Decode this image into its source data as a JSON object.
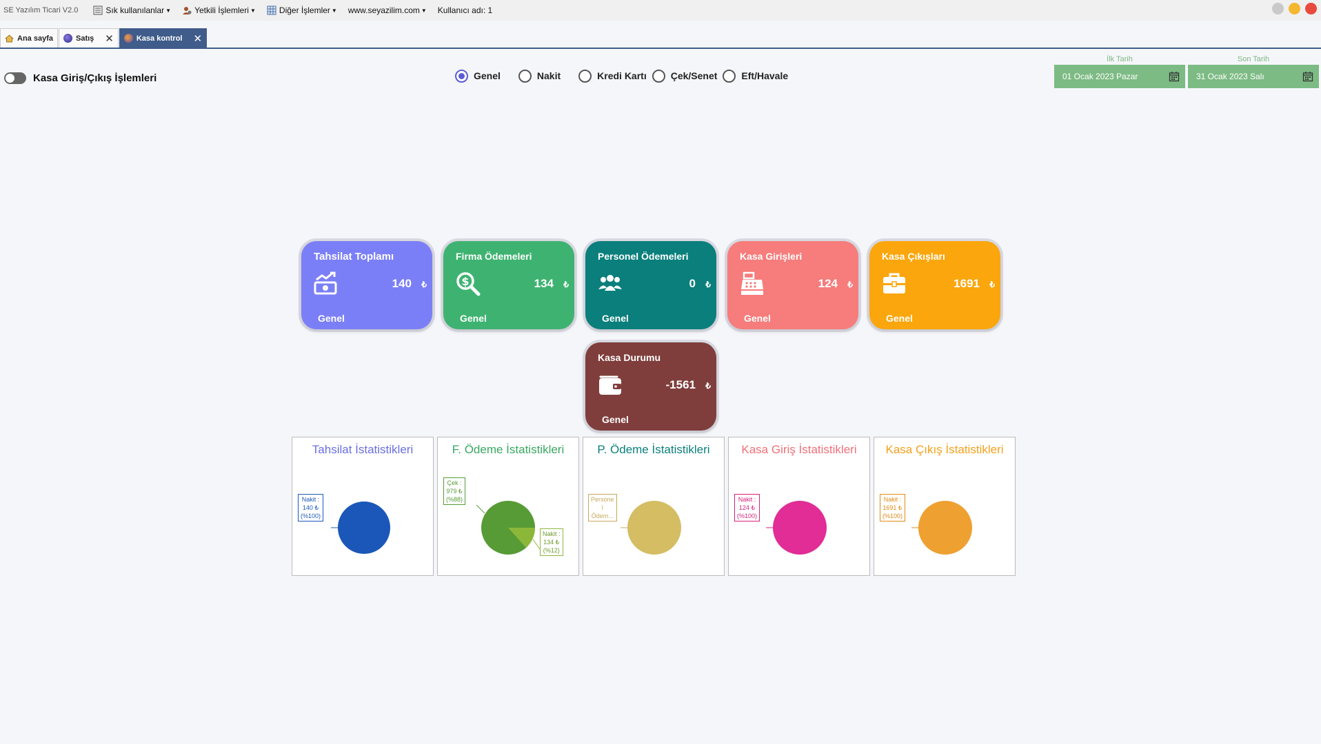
{
  "app": {
    "title": "SE Yazılım Ticari V2.0",
    "menu": [
      {
        "label": "Sık kullanılanlar",
        "icon": "menu-list-icon"
      },
      {
        "label": "Yetkili İşlemleri",
        "icon": "user-gear-icon"
      },
      {
        "label": "Diğer İşlemler",
        "icon": "grid-calc-icon"
      },
      {
        "label": "www.seyazilim.com",
        "icon": ""
      },
      {
        "label": "Kullanıcı adı: 1",
        "icon": ""
      }
    ],
    "window_buttons": [
      {
        "name": "maximize",
        "color": "#c9c9c9"
      },
      {
        "name": "minimize",
        "color": "#f5b731"
      },
      {
        "name": "close",
        "color": "#e84b3c"
      }
    ]
  },
  "tabs": [
    {
      "label": "Ana sayfa",
      "icon": "home-icon",
      "closable": false,
      "active": false
    },
    {
      "label": "Satış",
      "icon": "sales-globe-icon",
      "closable": true,
      "active": false
    },
    {
      "label": "Kasa kontrol",
      "icon": "cash-control-icon",
      "closable": true,
      "active": true
    }
  ],
  "toggle": {
    "label": "Kasa Giriş/Çıkış İşlemleri",
    "on": false
  },
  "payment_types": {
    "options": [
      "Genel",
      "Nakit",
      "Kredi Kartı",
      "Çek/Senet",
      "Eft/Havale"
    ],
    "selected": "Genel"
  },
  "dates": {
    "start": {
      "label": "İlk Tarih",
      "value": "01 Ocak 2023 Pazar"
    },
    "end": {
      "label": "Son Tarih",
      "value": "31 Ocak 2023 Salı"
    }
  },
  "cards": [
    {
      "title": "Tahsilat Toplamı",
      "value": "140",
      "currency": "₺",
      "footer": "Genel",
      "color": "#7b7ff7",
      "icon": "money-chart-icon"
    },
    {
      "title": "Firma Ödemeleri",
      "value": "134",
      "currency": "₺",
      "footer": "Genel",
      "color": "#3eb371",
      "icon": "dollar-search-icon"
    },
    {
      "title": "Personel Ödemeleri",
      "value": "0",
      "currency": "₺",
      "footer": "Genel",
      "color": "#0a7f7c",
      "icon": "people-icon"
    },
    {
      "title": "Kasa Girişleri",
      "value": "124",
      "currency": "₺",
      "footer": "Genel",
      "color": "#f77c7c",
      "icon": "cash-register-icon"
    },
    {
      "title": "Kasa Çıkışları",
      "value": "1691",
      "currency": "₺",
      "footer": "Genel",
      "color": "#fba60c",
      "icon": "briefcase-icon"
    },
    {
      "title": "Kasa Durumu",
      "value": "-1561",
      "currency": "₺",
      "footer": "Genel",
      "color": "#7f3e3c",
      "icon": "wallet-icon"
    }
  ],
  "stats": [
    {
      "title": "Tahsilat İstatistikleri",
      "color": "#6a6ee0",
      "slices": [
        {
          "value": 100,
          "color": "#1b57b8"
        }
      ],
      "labels": [
        [
          "Nakit :",
          "140 ₺",
          "(%100)"
        ]
      ],
      "label_color": "#1b57b8"
    },
    {
      "title": "F. Ödeme İstatistikleri",
      "color": "#38a862",
      "slices": [
        {
          "value": 88,
          "color": "#579b36"
        },
        {
          "value": 12,
          "color": "#8cb83a"
        }
      ],
      "labels": [
        [
          "Çek :",
          "979 ₺",
          "(%88)"
        ],
        [
          "Nakit :",
          "134 ₺",
          "(%12)"
        ]
      ],
      "label_color": "#579b36"
    },
    {
      "title": "P. Ödeme İstatistikleri",
      "color": "#0b7f7b",
      "slices": [
        {
          "value": 100,
          "color": "#d4bd62"
        }
      ],
      "labels": [
        [
          "Persone",
          "l",
          "Ödem..."
        ]
      ],
      "label_color": "#c5a85a"
    },
    {
      "title": "Kasa Giriş İstatistikleri",
      "color": "#f06f79",
      "slices": [
        {
          "value": 100,
          "color": "#e12d95"
        }
      ],
      "labels": [
        [
          "Nakit :",
          "124 ₺",
          "(%100)"
        ]
      ],
      "label_color": "#d81f78"
    },
    {
      "title": "Kasa Çıkış İstatistikleri",
      "color": "#f4a01a",
      "slices": [
        {
          "value": 100,
          "color": "#eea030"
        }
      ],
      "labels": [
        [
          "Nakit :",
          "1691 ₺",
          "(%100)"
        ]
      ],
      "label_color": "#e08a14"
    }
  ]
}
